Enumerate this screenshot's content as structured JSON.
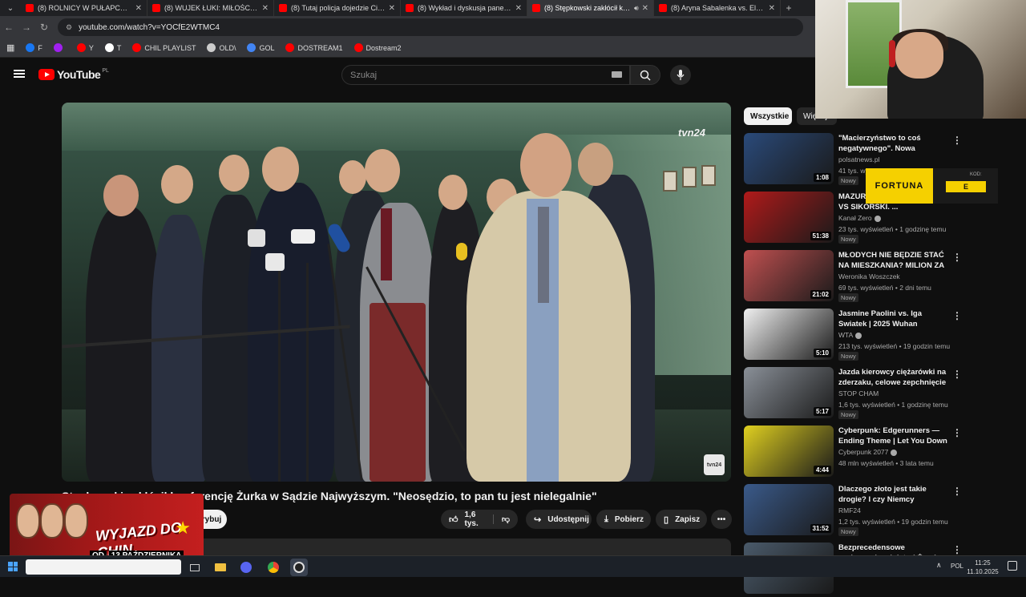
{
  "browser": {
    "tabs": [
      {
        "title": "(8) ROLNICY W PUŁAPCE. NIKT",
        "active": false
      },
      {
        "title": "(8) WUJEK ŁUKI: MIŁOŚCI, RELA",
        "active": false
      },
      {
        "title": "(8) Tutaj policja dojedzie Ciebie",
        "active": false
      },
      {
        "title": "(8) Wykład i dyskusja panelowa",
        "active": false
      },
      {
        "title": "(8) Stępkowski zakłócił konf",
        "active": true
      },
      {
        "title": "(8) Aryna Sabalenka vs. Elena R",
        "active": false
      }
    ],
    "url": "youtube.com/watch?v=YOCfE2WTMC4",
    "bookmarks": [
      {
        "label": "F",
        "color": "#1877f2"
      },
      {
        "label": "",
        "color": "#a020f0"
      },
      {
        "label": "Y",
        "color": "#ff0000"
      },
      {
        "label": "T",
        "color": "#ffffff"
      },
      {
        "label": "CHIL PLAYLIST",
        "color": "#ff0000"
      },
      {
        "label": "OLD\\",
        "color": "#cccccc"
      },
      {
        "label": "GOL",
        "color": "#4285f4"
      },
      {
        "label": "DOSTREAM1",
        "color": "#ff0000"
      },
      {
        "label": "Dostream2",
        "color": "#ff0000"
      }
    ]
  },
  "youtube": {
    "logo_text": "YouTube",
    "country_code": "PL",
    "search_placeholder": "Szukaj",
    "video": {
      "watermark": "tvn24",
      "corner_badge": "tvn24",
      "title": "Stępkowski zakłócił konferencję Żurka w Sądzie Najwyższym. \"Neosędzio, to pan tu jest nielegalnie\"",
      "subscribe_label": "Subskrybuj",
      "likes": "1,6 tys.",
      "share_label": "Udostępnij",
      "download_label": "Pobierz",
      "save_label": "Zapisz"
    },
    "promo": {
      "line1": "WYJAZD DO CHIN",
      "line2_prefix": "OD",
      "line2_date": "13 PAŹDZIERNIKA"
    },
    "sidebar": {
      "chips": [
        "Wszystkie",
        "Więcej"
      ],
      "items": [
        {
          "title": "\"Macierzyństwo to coś negatywnego\". Nowa ofensywa...",
          "channel": "polsatnews.pl",
          "verified": false,
          "meta": "41 tys. wyświetleń",
          "badge": "Nowy",
          "duration": "1:08",
          "thumb": "#2a4a7a"
        },
        {
          "title": "MAZUREK VS STERCZEWSKI VS SIKORSKI. ...",
          "channel": "Kanał Zero",
          "verified": true,
          "meta": "23 tys. wyświetleń • 1 godzinę temu",
          "badge": "Nowy",
          "duration": "51:38",
          "thumb": "#b01a1a"
        },
        {
          "title": "MŁODYCH NIE BĘDZIE STAĆ NA MIESZKANIA? MILION ZA ...",
          "channel": "Weronika Woszczek",
          "verified": false,
          "meta": "69 tys. wyświetleń • 2 dni temu",
          "badge": "Nowy",
          "duration": "21:02",
          "thumb": "#c05050"
        },
        {
          "title": "Jasmine Paolini vs. Iga Swiatek | 2025 Wuhan Quarterfinal | ...",
          "channel": "WTA",
          "verified": true,
          "meta": "213 tys. wyświetleń • 19 godzin temu",
          "badge": "Nowy",
          "duration": "5:10",
          "thumb": "#f0f0f0"
        },
        {
          "title": "Jazda kierowcy ciężarówki na zderzaku, celowe zepchnięcie ...",
          "channel": "STOP CHAM",
          "verified": false,
          "meta": "1,6 tys. wyświetleń • 1 godzinę temu",
          "badge": "Nowy",
          "duration": "5:17",
          "thumb": "#8a9098"
        },
        {
          "title": "Cyberpunk: Edgerunners — Ending Theme | Let You Down ...",
          "channel": "Cyberpunk 2077",
          "verified": true,
          "meta": "48 mln wyświetleń • 3 lata temu",
          "badge": "",
          "duration": "4:44",
          "thumb": "#e0d020"
        },
        {
          "title": "Dlaczego złoto jest takie drogie? I czy Niemcy zapewni...",
          "channel": "RMF24",
          "verified": false,
          "meta": "1,2 tys. wyświetleń • 19 godzin temu",
          "badge": "Nowy",
          "duration": "31:52",
          "thumb": "#3a5a8a"
        },
        {
          "title": "Bezprecedensowe zachowanie ministra! Żurek wchodzi siłą d...",
          "channel": "",
          "verified": false,
          "meta": "",
          "badge": "",
          "duration": "",
          "thumb": "#4a5a6a"
        }
      ]
    }
  },
  "ad": {
    "brand": "FORTUNA",
    "code_label": "KOD:",
    "code_value": "E"
  },
  "taskbar": {
    "lang": "POL",
    "time": "11:25",
    "date": "11.10.2025"
  }
}
